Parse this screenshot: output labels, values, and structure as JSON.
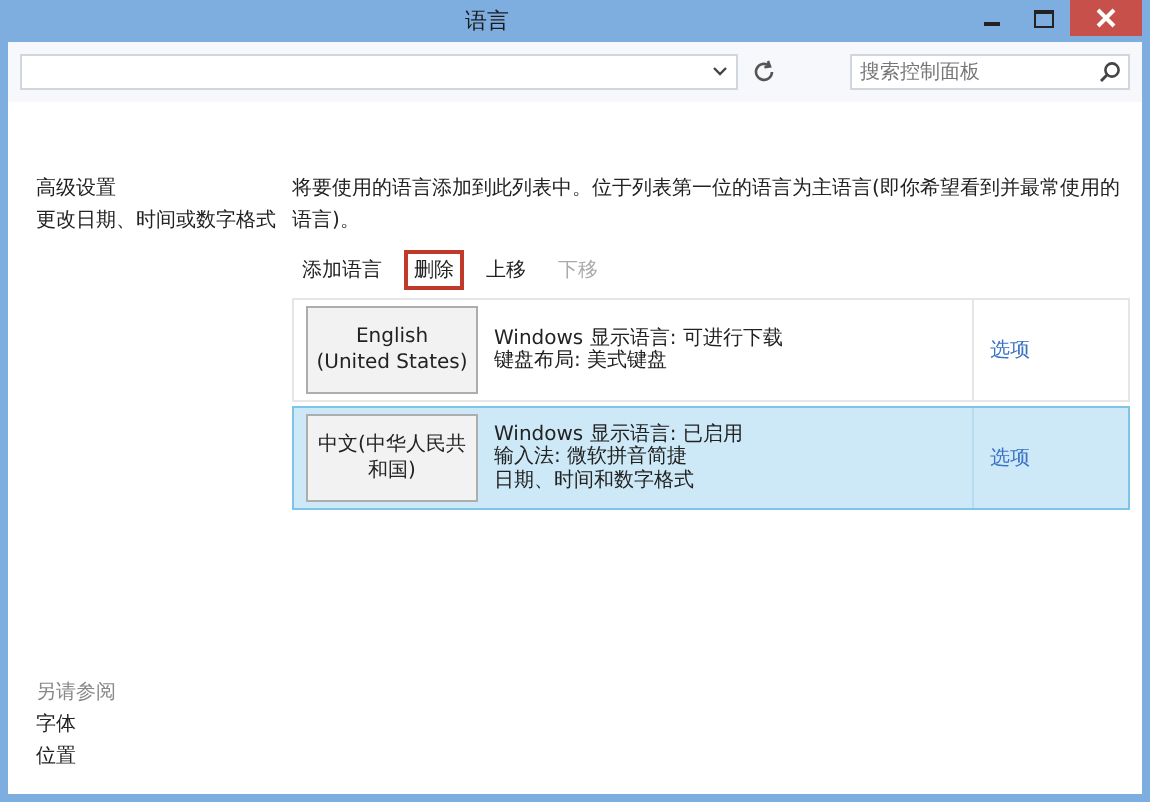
{
  "window": {
    "title": "语言"
  },
  "search": {
    "placeholder": "搜索控制面板"
  },
  "sidebar": {
    "items": [
      "高级设置",
      "更改日期、时间或数字格式"
    ]
  },
  "see_also": {
    "heading": "另请参阅",
    "links": [
      "字体",
      "位置"
    ]
  },
  "description": "将要使用的语言添加到此列表中。位于列表第一位的语言为主语言(即你希望看到并最常使用的语言)。",
  "toolbar": [
    {
      "label": "添加语言",
      "disabled": false,
      "highlighted": false
    },
    {
      "label": "删除",
      "disabled": false,
      "highlighted": true
    },
    {
      "label": "上移",
      "disabled": false,
      "highlighted": false
    },
    {
      "label": "下移",
      "disabled": true,
      "highlighted": false
    }
  ],
  "languages": [
    {
      "name": "English (United States)",
      "details": [
        "Windows 显示语言: 可进行下载",
        "键盘布局: 美式键盘"
      ],
      "options": "选项",
      "selected": false
    },
    {
      "name": "中文(中华人民共和国)",
      "details": [
        "Windows 显示语言: 已启用",
        "输入法: 微软拼音简捷",
        "日期、时间和数字格式"
      ],
      "options": "选项",
      "selected": true
    }
  ]
}
